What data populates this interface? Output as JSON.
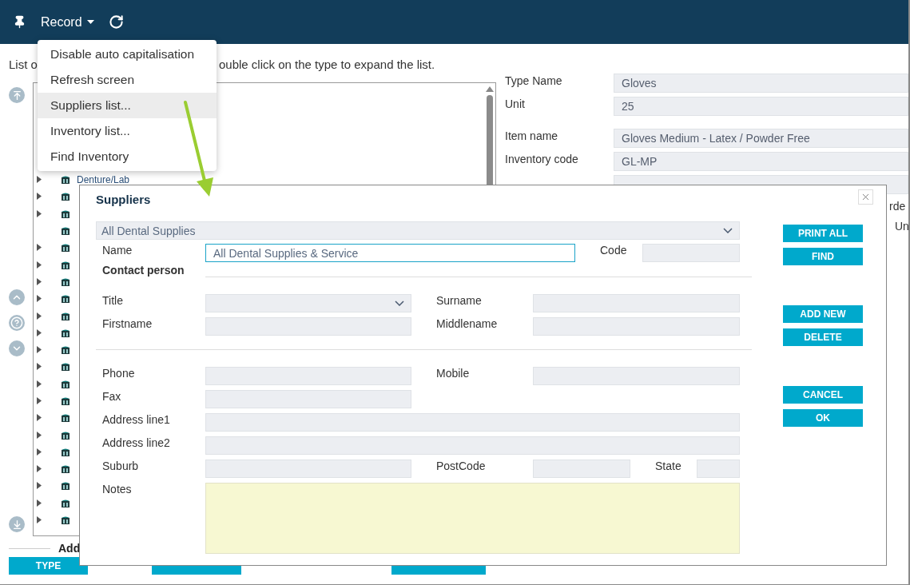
{
  "toolbar": {
    "menu_label": "Record"
  },
  "menu": {
    "items": [
      {
        "label": "Disable auto capitalisation",
        "selected": false
      },
      {
        "label": "Refresh screen",
        "selected": false
      },
      {
        "label": "Suppliers list...",
        "selected": true
      },
      {
        "label": "Inventory list...",
        "selected": false
      },
      {
        "label": "Find Inventory",
        "selected": false
      }
    ]
  },
  "instruction": [
    "List o",
    "ouble click on the type to expand the list."
  ],
  "tree": {
    "items": [
      {
        "label": "Denture/Lab",
        "expandable": true
      },
      {
        "expandable": true
      },
      {
        "expandable": true
      },
      {
        "expandable": false
      },
      {
        "expandable": true
      },
      {
        "expandable": true
      },
      {
        "expandable": true
      },
      {
        "expandable": true
      },
      {
        "expandable": true
      },
      {
        "expandable": true
      },
      {
        "expandable": true
      },
      {
        "expandable": true
      },
      {
        "expandable": true
      },
      {
        "expandable": true
      },
      {
        "expandable": true
      },
      {
        "expandable": true
      },
      {
        "expandable": true
      },
      {
        "expandable": true
      },
      {
        "expandable": true
      },
      {
        "expandable": true
      },
      {
        "expandable": true
      }
    ]
  },
  "item_form": {
    "fields": [
      {
        "label": "Type Name",
        "value": "Gloves"
      },
      {
        "label": "Unit",
        "value": "25"
      },
      {
        "label": "Item name",
        "value": "Gloves Medium - Latex / Powder Free"
      },
      {
        "label": "Inventory code",
        "value": "GL-MP"
      }
    ],
    "partial_labels": [
      "rde",
      "Un"
    ]
  },
  "bottom": {
    "add_label": "Add",
    "buttons": [
      "TYPE"
    ]
  },
  "dialog": {
    "title": "Suppliers",
    "supplier_select": "All Dental Supplies",
    "name": {
      "label": "Name",
      "value": "All Dental Supplies & Service"
    },
    "code": {
      "label": "Code"
    },
    "section": "Contact person",
    "title_field": {
      "label": "Title"
    },
    "surname": {
      "label": "Surname"
    },
    "firstname": {
      "label": "Firstname"
    },
    "middlename": {
      "label": "Middlename"
    },
    "phone": {
      "label": "Phone"
    },
    "mobile": {
      "label": "Mobile"
    },
    "fax": {
      "label": "Fax"
    },
    "address1": {
      "label": "Address line1"
    },
    "address2": {
      "label": "Address line2"
    },
    "suburb": {
      "label": "Suburb"
    },
    "postcode": {
      "label": "PostCode"
    },
    "state": {
      "label": "State"
    },
    "notes": {
      "label": "Notes"
    },
    "buttons": [
      [
        "PRINT ALL",
        "FIND"
      ],
      [
        "ADD NEW",
        "DELETE"
      ],
      [
        "CANCEL",
        "OK"
      ]
    ]
  }
}
